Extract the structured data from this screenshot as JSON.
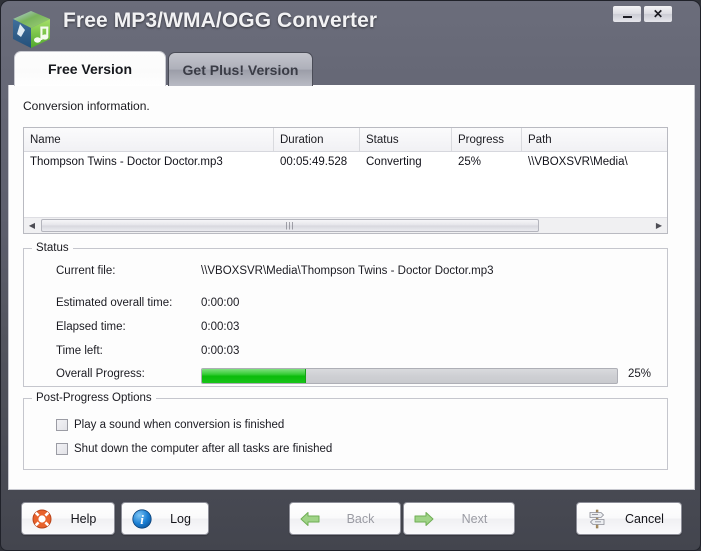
{
  "window": {
    "title": "Free MP3/WMA/OGG Converter",
    "app_icon": "music-cube-icon",
    "minimize_label": "–",
    "close_label": "✕"
  },
  "tabs": [
    {
      "label": "Free Version",
      "active": true
    },
    {
      "label": "Get Plus! Version",
      "active": false
    }
  ],
  "main": {
    "conversion_info_label": "Conversion information.",
    "list": {
      "columns": [
        "Name",
        "Duration",
        "Status",
        "Progress",
        "Path"
      ],
      "rows": [
        {
          "name": "Thompson Twins - Doctor Doctor.mp3",
          "duration": "00:05:49.528",
          "status": "Converting",
          "progress": "25%",
          "path": "\\\\VBOXSVR\\Media\\"
        }
      ],
      "scroll_left_arrow": "◀",
      "scroll_right_arrow": "▶",
      "scroll_grip": "|||"
    },
    "status_group": {
      "title": "Status",
      "rows": [
        {
          "label": "Current file:",
          "value": "\\\\VBOXSVR\\Media\\Thompson Twins - Doctor Doctor.mp3"
        },
        {
          "label": "Estimated overall time:",
          "value": "0:00:00"
        },
        {
          "label": "Elapsed time:",
          "value": "0:00:03"
        },
        {
          "label": "Time left:",
          "value": "0:00:03"
        }
      ],
      "progress_label": "Overall Progress:",
      "progress_percent": "25%",
      "progress_value": 25,
      "progress_color": "#0cbb0c"
    },
    "post_progress_group": {
      "title": "Post-Progress Options",
      "options": [
        {
          "label": "Play a sound when conversion is finished",
          "checked": false
        },
        {
          "label": "Shut down the computer after all tasks are finished",
          "checked": false
        }
      ]
    }
  },
  "buttons": {
    "help": {
      "label": "Help",
      "icon": "lifebuoy-icon",
      "disabled": false
    },
    "log": {
      "label": "Log",
      "icon": "info-icon",
      "disabled": false
    },
    "back": {
      "label": "Back",
      "icon": "arrow-left-icon",
      "disabled": true
    },
    "next": {
      "label": "Next",
      "icon": "arrow-right-icon",
      "disabled": true
    },
    "cancel": {
      "label": "Cancel",
      "icon": "signpost-icon",
      "disabled": false
    }
  }
}
